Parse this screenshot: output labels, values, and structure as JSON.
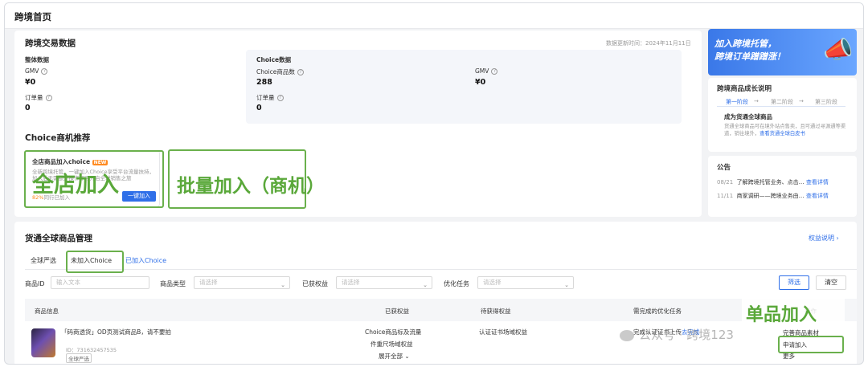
{
  "page": {
    "title": "跨境首页"
  },
  "trade": {
    "title": "跨境交易数据",
    "updated": "数据更新时间：2024年11月11日",
    "overall": {
      "title": "整体数据",
      "gmv_label": "GMV",
      "gmv_value": "¥0",
      "orders_label": "订单量",
      "orders_value": "0"
    },
    "choice": {
      "title": "Choice数据",
      "goods_label": "Choice商品数",
      "goods_value": "288",
      "gmv_label": "GMV",
      "gmv_value": "¥0",
      "orders_label": "订单量",
      "orders_value": "0"
    }
  },
  "recommend": {
    "title": "Choice商机推荐",
    "card_title": "全店商品加入choice",
    "card_badge": "NEW",
    "card_desc": "全新跨境托管，一键加入Choice享受平台流量扶持，加入后无需额外操作即可开启全球销售之旅",
    "card_pct": "82%",
    "card_pct_suffix": "同行已加入",
    "card_button": "一键加入"
  },
  "annotations": {
    "store": "全店加入",
    "batch": "批量加入（商机）",
    "single": "单品加入"
  },
  "banner": {
    "line1": "加入跨境托管，",
    "line2": "跨境订单蹭蹭涨！"
  },
  "growth": {
    "title": "跨境商品成长说明",
    "steps": [
      "第一阶段",
      "第二阶段",
      "第三阶段"
    ],
    "subtitle": "成为货通全球商品",
    "desc": "货通全球商品可在境外站点售卖，且可通过寻源通等渠道，销往境外，",
    "link": "查看货通全球白皮书"
  },
  "notice": {
    "title": "公告",
    "items": [
      {
        "date": "08/21",
        "text": "了解跨境托管业务、点击…",
        "link": "查看详情"
      },
      {
        "date": "11/11",
        "text": "商家调研——跨境业务由…",
        "link": "查看详情"
      }
    ]
  },
  "goods": {
    "title": "货通全球商品管理",
    "rights_link": "权益说明",
    "tabs": [
      "全球严选",
      "未加入Choice",
      "已加入Choice"
    ],
    "filters": {
      "id_label": "商品ID",
      "id_placeholder": "输入文本",
      "type_label": "商品类型",
      "type_placeholder": "请选择",
      "rights_label": "已获权益",
      "rights_placeholder": "请选择",
      "task_label": "优化任务",
      "task_placeholder": "请选择",
      "filter_btn": "筛选",
      "clear_btn": "清空"
    },
    "columns": [
      "商品信息",
      "已获权益",
      "待获得权益",
      "需完成的优化任务",
      "操作"
    ],
    "row": {
      "name": "「码商透货」OD页测试商品B，请不要拍",
      "id": "ID：731632457535",
      "tag": "全球严选",
      "rights1": "Choice商品标及流量",
      "rights2": "件重尺场域权益",
      "expand": "展开全部",
      "pending": "认证证书场域权益",
      "task": "完成认证证书上传",
      "task_link": "去完成",
      "op1": "完善商品素材",
      "op2": "申请加入",
      "op3": "更多"
    }
  },
  "watermark": "公众号 · 跨境123"
}
